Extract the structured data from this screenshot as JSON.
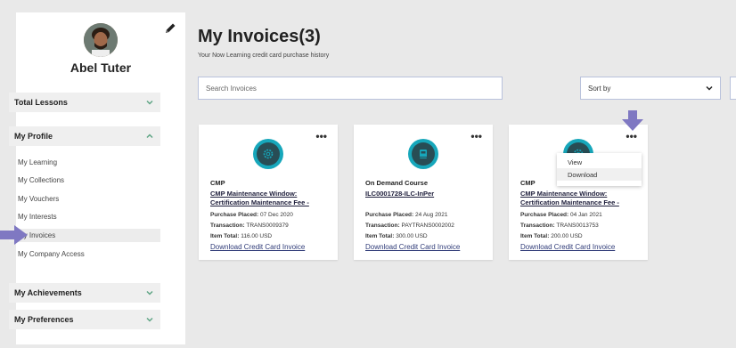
{
  "user": {
    "name": "Abel Tuter"
  },
  "sidebar": {
    "sections": [
      {
        "label": "Total Lessons",
        "state": "collapsed"
      },
      {
        "label": "My Profile",
        "state": "expanded"
      },
      {
        "label": "My Achievements",
        "state": "collapsed"
      },
      {
        "label": "My Preferences",
        "state": "collapsed"
      }
    ],
    "profile_items": [
      {
        "label": "My Learning"
      },
      {
        "label": "My Collections"
      },
      {
        "label": "My Vouchers"
      },
      {
        "label": "My Interests"
      },
      {
        "label": "My Invoices",
        "active": true
      },
      {
        "label": "My Company Access"
      }
    ]
  },
  "main": {
    "title": "My Invoices(3)",
    "subtitle": "Your Now Learning credit card purchase history",
    "search_placeholder": "Search Invoices",
    "sort_label": "Sort by"
  },
  "cards": [
    {
      "category": "CMP",
      "title": "CMP Maintenance Window: Certification Maintenance Fee -",
      "purchase_label": "Purchase Placed:",
      "purchase_date": "07 Dec 2020",
      "transaction_label": "Transaction:",
      "transaction": "TRANS0009379",
      "total_label": "Item Total:",
      "total": "116.00 USD",
      "download_label": "Download Credit Card Invoice",
      "icon": "gear-icon"
    },
    {
      "category": "On Demand Course",
      "title": "ILC0001728-ILC-InPer",
      "purchase_label": "Purchase Placed:",
      "purchase_date": "24 Aug 2021",
      "transaction_label": "Transaction:",
      "transaction": "PAYTRANS0002002",
      "total_label": "Item Total:",
      "total": "300.00 USD",
      "download_label": "Download Credit Card Invoice",
      "icon": "book-icon"
    },
    {
      "category": "CMP",
      "title": "CMP Maintenance Window: Certification Maintenance Fee -",
      "purchase_label": "Purchase Placed:",
      "purchase_date": "04 Jan 2021",
      "transaction_label": "Transaction:",
      "transaction": "TRANS0013753",
      "total_label": "Item Total:",
      "total": "200.00 USD",
      "download_label": "Download Credit Card Invoice",
      "icon": "gear-icon"
    }
  ],
  "card_menu": {
    "view": "View",
    "download": "Download"
  },
  "colors": {
    "accent_teal": "#17a7bb",
    "annotation_arrow": "#7f78c2",
    "link": "#2f3b78"
  }
}
